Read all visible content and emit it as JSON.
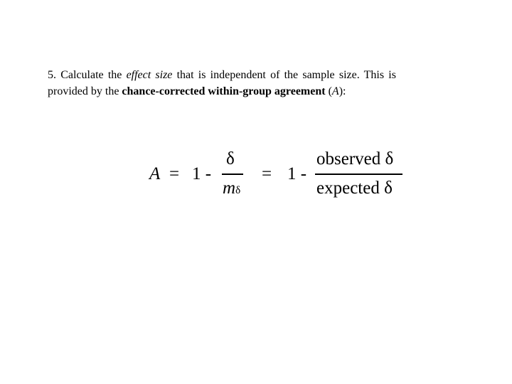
{
  "paragraph": {
    "line1": {
      "pre": "5. Calculate the ",
      "italic": "effect size",
      "post": " that is independent of the sample size.  This is"
    },
    "line2": {
      "pre": "provided by the ",
      "bold": "chance-corrected within-group agreement",
      "mid": " (",
      "italic": "A",
      "post": "):"
    }
  },
  "formula": {
    "lhs": "A",
    "eq1": "=",
    "one1": "1 -",
    "frac1_num": "δ",
    "frac1_den_m": "m",
    "frac1_den_sub": "δ",
    "eq2": "=",
    "one2": "1 -",
    "frac2_num": "observed δ",
    "frac2_den": "expected δ"
  }
}
